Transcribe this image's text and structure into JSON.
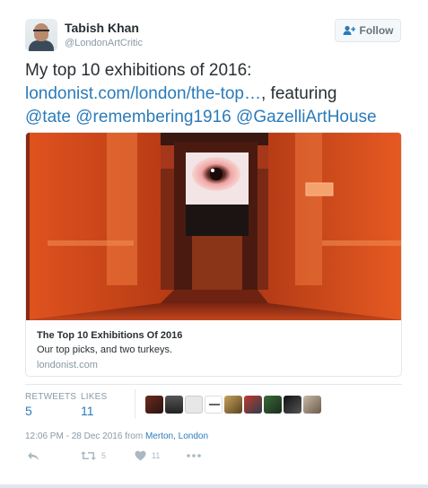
{
  "user": {
    "name": "Tabish Khan",
    "handle": "@LondonArtCritic"
  },
  "follow_button": {
    "label": "Follow"
  },
  "tweet": {
    "text_line1": "My top 10 exhibitions of 2016:",
    "link": "londonist.com/london/the-top…",
    "link_suffix": ", featuring",
    "mentions": [
      "@tate",
      "@remembering1916",
      "@GazelliArtHouse"
    ]
  },
  "card": {
    "title": "The Top 10 Exhibitions Of 2016",
    "description": "Our top picks, and two turkeys.",
    "domain": "londonist.com"
  },
  "stats": {
    "retweets_label": "RETWEETS",
    "retweets_value": "5",
    "likes_label": "LIKES",
    "likes_value": "11"
  },
  "timestamp": {
    "text": "12:06 PM - 28 Dec 2016 from ",
    "location": "Merton, London"
  },
  "actions": {
    "retweet_count": "5",
    "like_count": "11"
  },
  "colors": {
    "link": "#2b7bb9",
    "muted": "#8899a6",
    "border": "#e1e8ed"
  },
  "icons": {
    "follow": "add-user-icon",
    "reply": "reply-icon",
    "retweet": "retweet-icon",
    "like": "heart-icon",
    "more": "more-icon"
  }
}
